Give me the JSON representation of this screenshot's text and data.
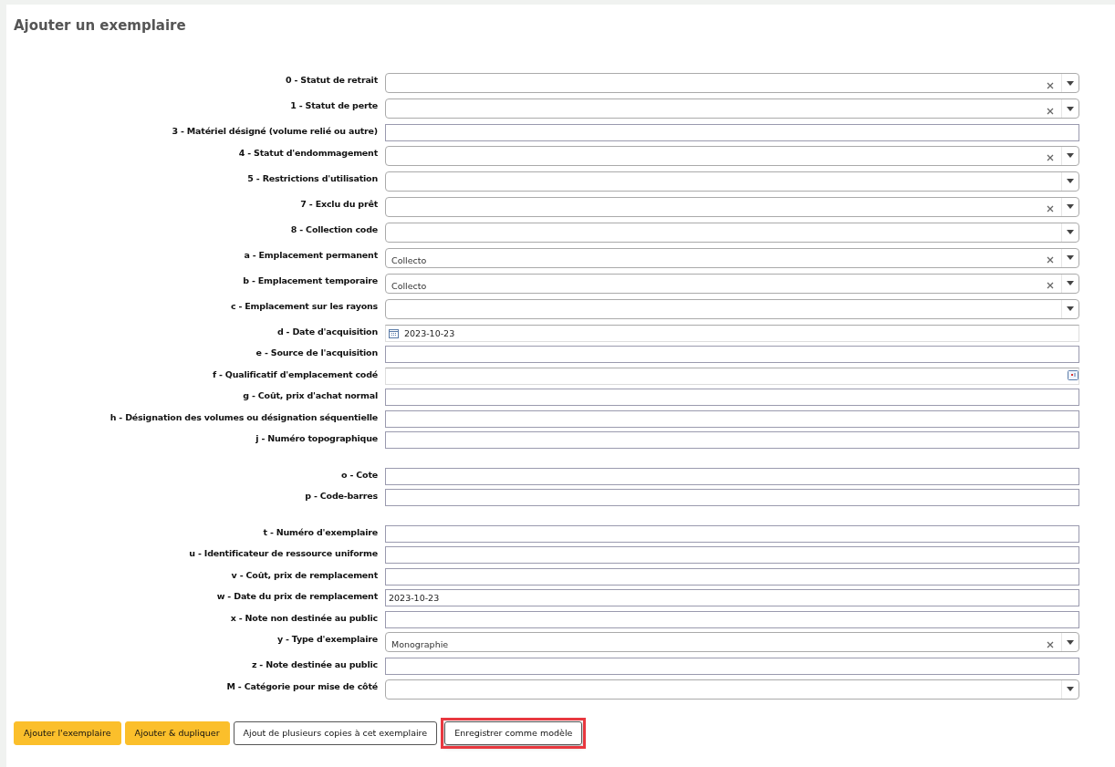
{
  "title": "Ajouter un exemplaire",
  "groups": [
    {
      "fields": [
        {
          "label": "0 - Statut de retrait",
          "kind": "select",
          "clearable": true
        },
        {
          "label": "1 - Statut de perte",
          "kind": "select",
          "clearable": true
        },
        {
          "label": "3 - Matériel désigné (volume relié ou autre)",
          "kind": "text"
        },
        {
          "label": "4 - Statut d'endommagement",
          "kind": "select",
          "clearable": true
        },
        {
          "label": "5 - Restrictions d'utilisation",
          "kind": "select",
          "clearable": false
        },
        {
          "label": "7 - Exclu du prêt",
          "kind": "select",
          "clearable": true
        },
        {
          "label": "8 - Collection code",
          "kind": "select",
          "clearable": false
        },
        {
          "label": "a - Emplacement permanent",
          "kind": "select",
          "clearable": true,
          "value": "Collecto"
        },
        {
          "label": "b - Emplacement temporaire",
          "kind": "select",
          "clearable": true,
          "value": "Collecto"
        },
        {
          "label": "c - Emplacement sur les rayons",
          "kind": "select",
          "clearable": false
        },
        {
          "label": "d - Date d'acquisition",
          "kind": "date",
          "value": "2023-10-23"
        },
        {
          "label": "e - Source de l'acquisition",
          "kind": "text"
        },
        {
          "label": "f - Qualificatif d'emplacement codé",
          "kind": "plugin"
        },
        {
          "label": "g - Coût, prix d'achat normal",
          "kind": "text"
        },
        {
          "label": "h - Désignation des volumes ou désignation séquentielle",
          "kind": "text"
        },
        {
          "label": "j - Numéro topographique",
          "kind": "text"
        }
      ]
    },
    {
      "fields": [
        {
          "label": "o - Cote",
          "kind": "text"
        },
        {
          "label": "p - Code-barres",
          "kind": "text"
        }
      ]
    },
    {
      "fields": [
        {
          "label": "t - Numéro d'exemplaire",
          "kind": "text"
        },
        {
          "label": "u - Identificateur de ressource uniforme",
          "kind": "text"
        },
        {
          "label": "v - Coût, prix de remplacement",
          "kind": "text"
        },
        {
          "label": "w - Date du prix de remplacement",
          "kind": "text",
          "value": "2023-10-23"
        },
        {
          "label": "x - Note non destinée au public",
          "kind": "text"
        },
        {
          "label": "y - Type d'exemplaire",
          "kind": "select",
          "clearable": true,
          "value": "Monographie"
        },
        {
          "label": "z - Note destinée au public",
          "kind": "text"
        },
        {
          "label": "M - Catégorie pour mise de côté",
          "kind": "select",
          "clearable": false
        }
      ]
    }
  ],
  "buttons": [
    {
      "label": "Ajouter l'exemplaire",
      "kind": "primary",
      "highlighted": false
    },
    {
      "label": "Ajouter & dupliquer",
      "kind": "primary",
      "highlighted": false
    },
    {
      "label": "Ajout de plusieurs copies à cet exemplaire",
      "kind": "secondary",
      "highlighted": false
    },
    {
      "label": "Enregistrer comme modèle",
      "kind": "secondary",
      "highlighted": true
    }
  ]
}
